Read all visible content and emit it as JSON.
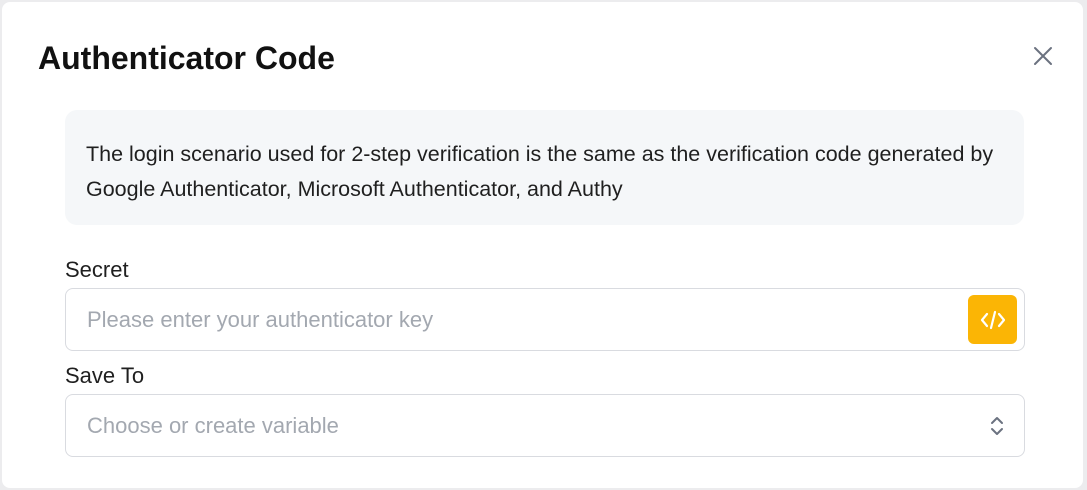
{
  "dialog": {
    "title": "Authenticator Code",
    "close_icon": "close-icon",
    "info": "The login scenario used for 2-step verification is the same as the verification code generated by Google Authenticator, Microsoft Authenticator, and Authy"
  },
  "secret": {
    "label": "Secret",
    "placeholder": "Please enter your authenticator key",
    "value": "",
    "code_button_icon": "code-icon"
  },
  "save_to": {
    "label": "Save To",
    "placeholder": "Choose or create variable",
    "chevron_icon": "chevron-up-down-icon"
  },
  "colors": {
    "accent": "#fbb505",
    "info_bg": "#f5f7f9",
    "border": "#d9dbe0",
    "placeholder": "#a3a8b0"
  }
}
